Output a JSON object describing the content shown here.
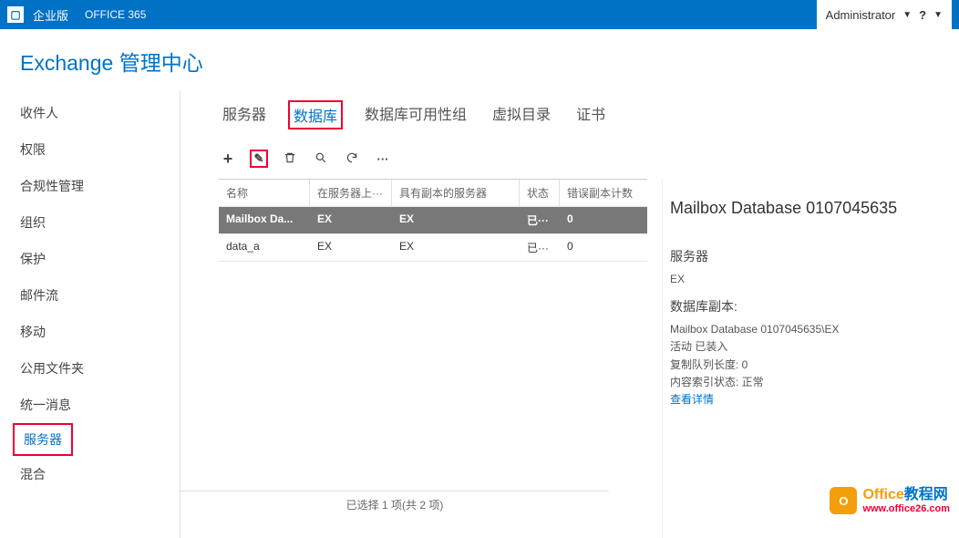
{
  "topbar": {
    "brand": "企业版",
    "product": "OFFICE 365",
    "admin": "Administrator",
    "help": "?"
  },
  "pageTitle": "Exchange 管理中心",
  "sidebar": {
    "items": [
      "收件人",
      "权限",
      "合规性管理",
      "组织",
      "保护",
      "邮件流",
      "移动",
      "公用文件夹",
      "统一消息",
      "服务器",
      "混合"
    ],
    "activeIndex": 9
  },
  "tabs": {
    "items": [
      "服务器",
      "数据库",
      "数据库可用性组",
      "虚拟目录",
      "证书"
    ],
    "activeIndex": 1
  },
  "toolbar": {
    "add": "+",
    "edit": "✎",
    "delete": "🗑",
    "search": "🔍",
    "refresh": "↻",
    "more": "···"
  },
  "table": {
    "headers": [
      "名称",
      "在服务器上···",
      "具有副本的服务器",
      "状态",
      "错误副本计数"
    ],
    "rows": [
      {
        "cells": [
          "Mailbox Da...",
          "EX",
          "EX",
          "已···",
          "0"
        ],
        "selected": true
      },
      {
        "cells": [
          "data_a",
          "EX",
          "EX",
          "已···",
          "0"
        ],
        "selected": false
      }
    ]
  },
  "details": {
    "title": "Mailbox Database 0107045635",
    "server_label": "服务器",
    "server_value": "EX",
    "copies_label": "数据库副本:",
    "copy_path": "Mailbox Database 0107045635\\EX",
    "activity": "活动 已装入",
    "queue": "复制队列长度: 0",
    "index": "内容索引状态: 正常",
    "view_details": "查看详情"
  },
  "footer": "已选择 1 项(共 2 项)",
  "watermark": {
    "text1a": "Office",
    "text1b": "教程网",
    "url": "www.office26.com"
  }
}
